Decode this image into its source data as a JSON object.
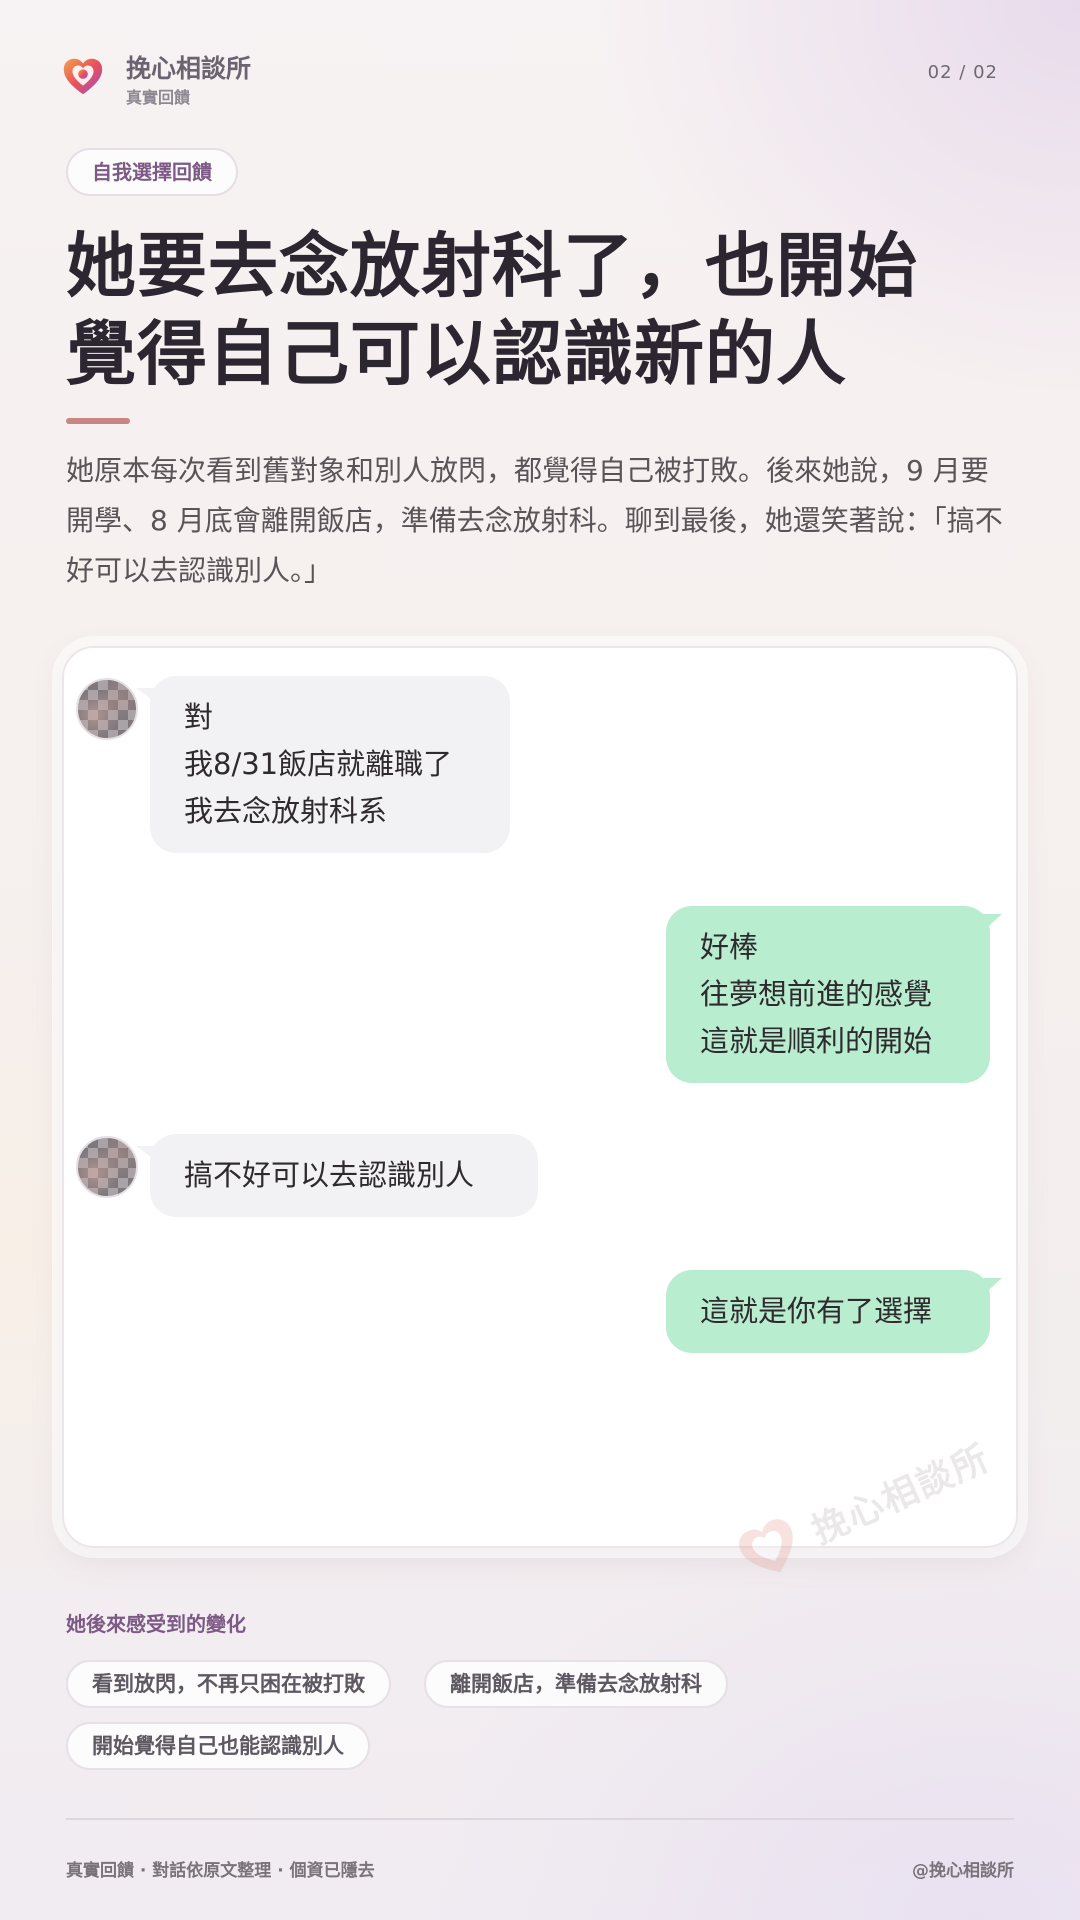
{
  "header": {
    "brand_name": "挽心相談所",
    "brand_sub": "真實回饋",
    "page_indicator": "02 / 02",
    "logo_icon": "heart-swirl-icon"
  },
  "tag": "自我選擇回饋",
  "headline": "她要去念放射科了，也開始覺得自己可以認識新的人",
  "intro": "她原本每次看到舊對象和別人放閃，都覺得自己被打敗。後來她說，9 月要開學、8 月底會離開飯店，準備去念放射科。聊到最後，她還笑著說：「搞不好可以去認識別人。」",
  "chat": {
    "messages": [
      {
        "side": "incoming",
        "text": "對\n我8/31飯店就離職了\n我去念放射科系"
      },
      {
        "side": "outgoing",
        "text": "好棒\n往夢想前進的感覺\n這就是順利的開始"
      },
      {
        "side": "incoming",
        "text": "搞不好可以去認識別人"
      },
      {
        "side": "outgoing",
        "text": "這就是你有了選擇"
      }
    ],
    "watermark": "挽心相談所"
  },
  "changes": {
    "title": "她後來感受到的變化",
    "chips": [
      "看到放閃，不再只困在被打敗",
      "離開飯店，準備去念放射科",
      "開始覺得自己也能認識別人"
    ]
  },
  "footer": {
    "left": "真實回饋 · 對話依原文整理 · 個資已隱去",
    "right": "@挽心相談所"
  },
  "colors": {
    "accent_purple": "#7d5a86",
    "accent_bar": "#c98582",
    "incoming_bubble": "#f2f2f4",
    "outgoing_bubble": "#b8edd0"
  }
}
